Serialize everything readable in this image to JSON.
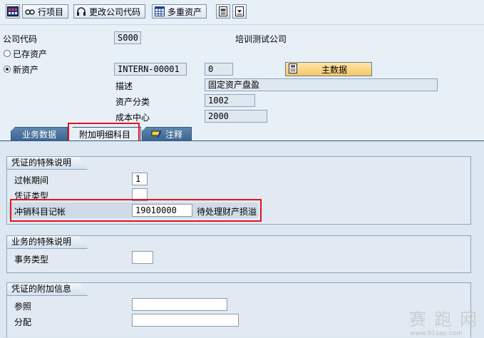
{
  "toolbar": {
    "items_label": "行项目",
    "change_company_label": "更改公司代码",
    "multiple_assets_label": "多重资产"
  },
  "header": {
    "company_code_label": "公司代码",
    "company_code_value": "S000",
    "company_name": "培训测试公司",
    "existing_asset_label": "已存资产",
    "new_asset_label": "新资产",
    "asset_number": "INTERN-00001",
    "sub_number": "0",
    "master_data_label": "主数据",
    "description_label": "描述",
    "description_value": "固定资产盘盈",
    "asset_class_label": "资产分类",
    "asset_class_value": "1002",
    "cost_center_label": "成本中心",
    "cost_center_value": "2000"
  },
  "tabs": [
    {
      "label": "业务数据"
    },
    {
      "label": "附加明细科目"
    },
    {
      "label": "注释"
    }
  ],
  "group1": {
    "title": "凭证的特殊说明",
    "posting_period_label": "过帐期间",
    "posting_period_value": "1",
    "doc_type_label": "凭证类型",
    "doc_type_value": "",
    "offset_label": "冲销科目记帐",
    "offset_value": "19010000",
    "offset_desc": "待处理财产损溢"
  },
  "group2": {
    "title": "业务的特殊说明",
    "trans_type_label": "事务类型",
    "trans_type_value": ""
  },
  "group3": {
    "title": "凭证的附加信息",
    "reference_label": "参照",
    "reference_value": "",
    "assignment_label": "分配",
    "assignment_value": ""
  },
  "watermark": {
    "text": "赛 跑 网",
    "url": "www.91sap.com"
  },
  "colors": {
    "background": "#e7eff7",
    "tab_blue": "#3c6592",
    "highlight_red": "#e0141e",
    "master_button": "#f5c767"
  }
}
